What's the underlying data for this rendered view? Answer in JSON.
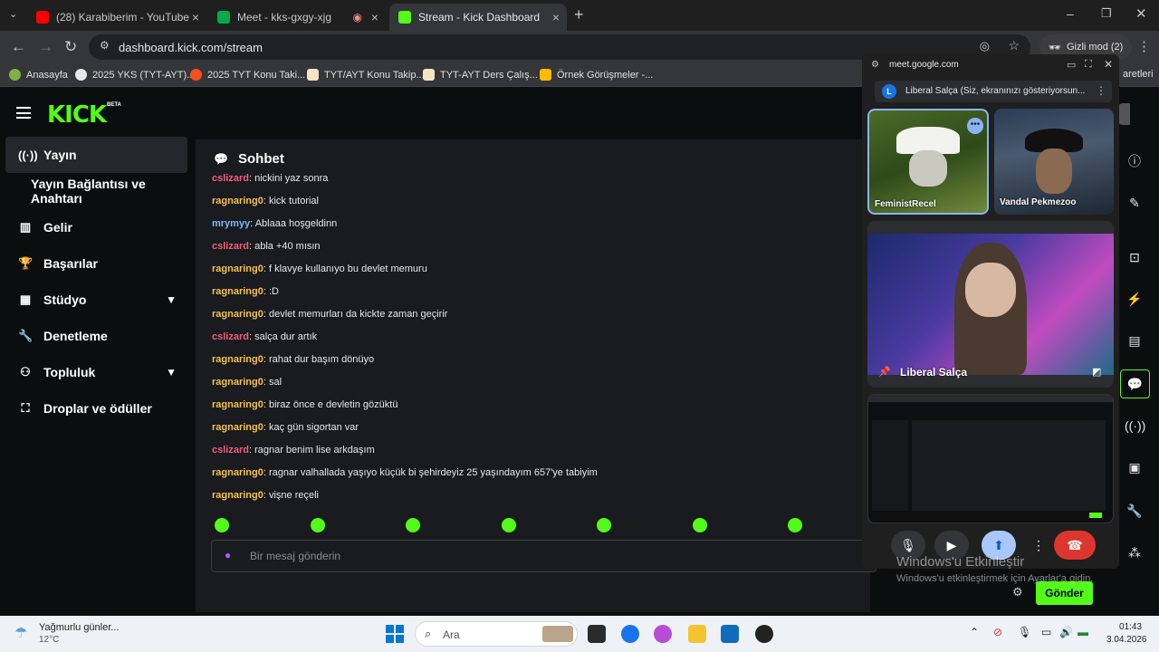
{
  "tabs": [
    {
      "title": "(28) Karabiberim - YouTube",
      "color": "#ff0000"
    },
    {
      "title": "Meet - kks-gxgy-xjg",
      "color": "#00ac47"
    },
    {
      "title": "Stream - Kick Dashboard",
      "color": "#53fc18"
    }
  ],
  "browser": {
    "url": "dashboard.kick.com/stream",
    "incognito": "Gizli mod (2)",
    "bookmarks": [
      "Anasayfa",
      "2025 YKS (TYT-AYT)...",
      "2025 TYT Konu Taki...",
      "TYT/AYT Konu Takip...",
      "TYT-AYT Ders Çalış...",
      "Örnek Görüşmeler -..."
    ],
    "bookmarks_right": "aretleri"
  },
  "kick": {
    "logo": "KICK",
    "beta": "BETA",
    "sidebar": [
      {
        "label": "Yayın",
        "icon": "broadcast-icon"
      },
      {
        "label": "Yayın Bağlantısı ve Anahtarı"
      },
      {
        "label": "Gelir",
        "icon": "chart-icon"
      },
      {
        "label": "Başarılar",
        "icon": "trophy-icon"
      },
      {
        "label": "Stüdyo",
        "icon": "grid-icon"
      },
      {
        "label": "Denetleme",
        "icon": "wrench-icon"
      },
      {
        "label": "Topluluk",
        "icon": "community-icon"
      },
      {
        "label": "Droplar ve ödüller",
        "icon": "gift-icon"
      }
    ],
    "chat": {
      "title": "Sohbet",
      "messages": [
        {
          "user": "cslizard",
          "text": ": nickini yaz sonra",
          "color": "#f25d7a"
        },
        {
          "user": "ragnaring0",
          "text": ": kick tutorial",
          "color": "#f7c04b"
        },
        {
          "user": "mrymyy",
          "text": ": Ablaaa hoşgeldinn",
          "color": "#7fb5ff"
        },
        {
          "user": "cslizard",
          "text": ": abla +40 mısın",
          "color": "#f25d7a"
        },
        {
          "user": "ragnaring0",
          "text": ": f klavye kullanıyo bu devlet memuru",
          "color": "#f7c04b"
        },
        {
          "user": "ragnaring0",
          "text": ": :D",
          "color": "#f7c04b"
        },
        {
          "user": "ragnaring0",
          "text": ": devlet memurları da kickte zaman geçirir",
          "color": "#f7c04b"
        },
        {
          "user": "cslizard",
          "text": ": salça dur artık",
          "color": "#f25d7a"
        },
        {
          "user": "ragnaring0",
          "text": ": rahat dur başım dönüyo",
          "color": "#f7c04b"
        },
        {
          "user": "ragnaring0",
          "text": ": sal",
          "color": "#f7c04b"
        },
        {
          "user": "ragnaring0",
          "text": ": biraz önce e devletin gözüktü",
          "color": "#f7c04b"
        },
        {
          "user": "ragnaring0",
          "text": ": kaç gün sigortan var",
          "color": "#f7c04b"
        },
        {
          "user": "cslizard",
          "text": ": ragnar benim lise arkdaşım",
          "color": "#f25d7a"
        },
        {
          "user": "ragnaring0",
          "text": ": ragnar valhallada yaşıyo küçük bi şehirdeyiz 25 yaşındayım 657'ye tabiyim",
          "color": "#f7c04b"
        },
        {
          "user": "ragnaring0",
          "text": ": vişne reçeli",
          "color": "#f7c04b"
        }
      ],
      "placeholder": "Bir mesaj gönderin",
      "send": "Gönder"
    }
  },
  "meet": {
    "domain": "meet.google.com",
    "avatar_letter": "L",
    "banner": "Liberal Salça (Siz, ekranınızı gösteriyorsun...",
    "participants": [
      "FeministRecel",
      "Vandal Pekmezoo",
      "Liberal Salça"
    ]
  },
  "watermark": {
    "line1": "Windows'u Etkinleştir",
    "line2": "Windows'u etkinleştirmek için Ayarlar'a gidin."
  },
  "taskbar": {
    "weather": "Yağmurlu günler...",
    "temp": "12°C",
    "search": "Ara",
    "time": "01:43",
    "date": "3.04.2026"
  }
}
